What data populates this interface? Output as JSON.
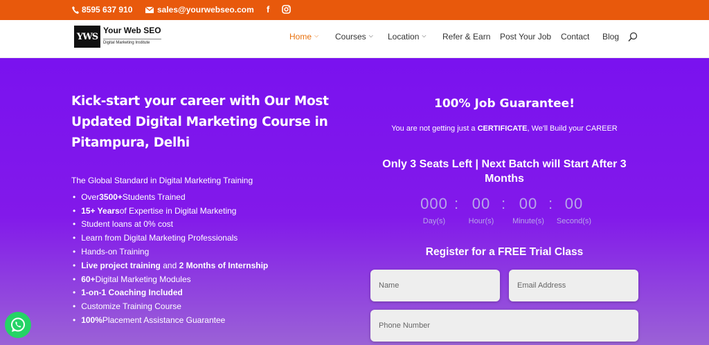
{
  "topbar": {
    "phone": "8595 637 910",
    "email": "sales@yourwebseo.com",
    "facebook_icon": "facebook-icon",
    "instagram_icon": "instagram-icon"
  },
  "logo": {
    "mark": "YWS",
    "name": "Your Web SEO",
    "tagline": "Digital Marketing Institute"
  },
  "nav": {
    "items": [
      {
        "label": "Home",
        "dropdown": true,
        "active": true
      },
      {
        "label": "Courses",
        "dropdown": true
      },
      {
        "label": "Location",
        "dropdown": true
      },
      {
        "label": "Refer & Earn",
        "dropdown": false
      },
      {
        "label": "Post Your Job",
        "dropdown": false
      },
      {
        "label": "Contact",
        "dropdown": false
      },
      {
        "label": "Blog",
        "dropdown": false
      }
    ]
  },
  "hero": {
    "headline": "Kick-start your career with Our Most Updated Digital Marketing Course in Pitampura, Delhi",
    "intro": "The Global Standard in Digital Marketing Training",
    "bullets": [
      {
        "bold": "",
        "pre": "Over ",
        "strong": "3500+",
        "post": " Students Trained"
      },
      {
        "pre": "",
        "strong": "15+ Years",
        "post": " of Expertise in Digital Marketing"
      },
      {
        "pre": "Student loans at 0% cost",
        "strong": "",
        "post": ""
      },
      {
        "pre": "Learn from Digital Marketing Professionals",
        "strong": "",
        "post": ""
      },
      {
        "pre": "Hands-on Training",
        "strong": "",
        "post": ""
      },
      {
        "pre": "",
        "strong": "Live project training",
        "post": " and ",
        "strong2": "2 Months of Internship"
      },
      {
        "pre": "",
        "strong": "60+",
        "post": " Digital Marketing Modules"
      },
      {
        "pre": "",
        "strong": "1-on-1 Coaching Included",
        "post": ""
      },
      {
        "pre": "Customize Training Course",
        "strong": "",
        "post": ""
      },
      {
        "pre": "",
        "strong": "100%",
        "post": " Placement Assistance Guarantee"
      }
    ]
  },
  "offer": {
    "guarantee": "100% Job Guarantee!",
    "cert_pre": "You are not getting just a ",
    "cert_strong": "CERTIFICATE",
    "cert_post": ", We'll Build your CAREER",
    "seats": "Only 3 Seats Left | Next Batch will Start After 3 Months",
    "countdown": [
      {
        "value": "000",
        "label": "Day(s)"
      },
      {
        "value": "00",
        "label": "Hour(s)"
      },
      {
        "value": "00",
        "label": "Minute(s)"
      },
      {
        "value": "00",
        "label": "Second(s)"
      }
    ],
    "register": "Register for a FREE Trial Class",
    "form": {
      "name_placeholder": "Name",
      "email_placeholder": "Email Address",
      "phone_placeholder": "Phone Number"
    }
  },
  "colors": {
    "topbar": "#e8590c",
    "active_nav": "#e8700c",
    "hero_purple": "#7a12ef",
    "whatsapp": "#25d366"
  }
}
